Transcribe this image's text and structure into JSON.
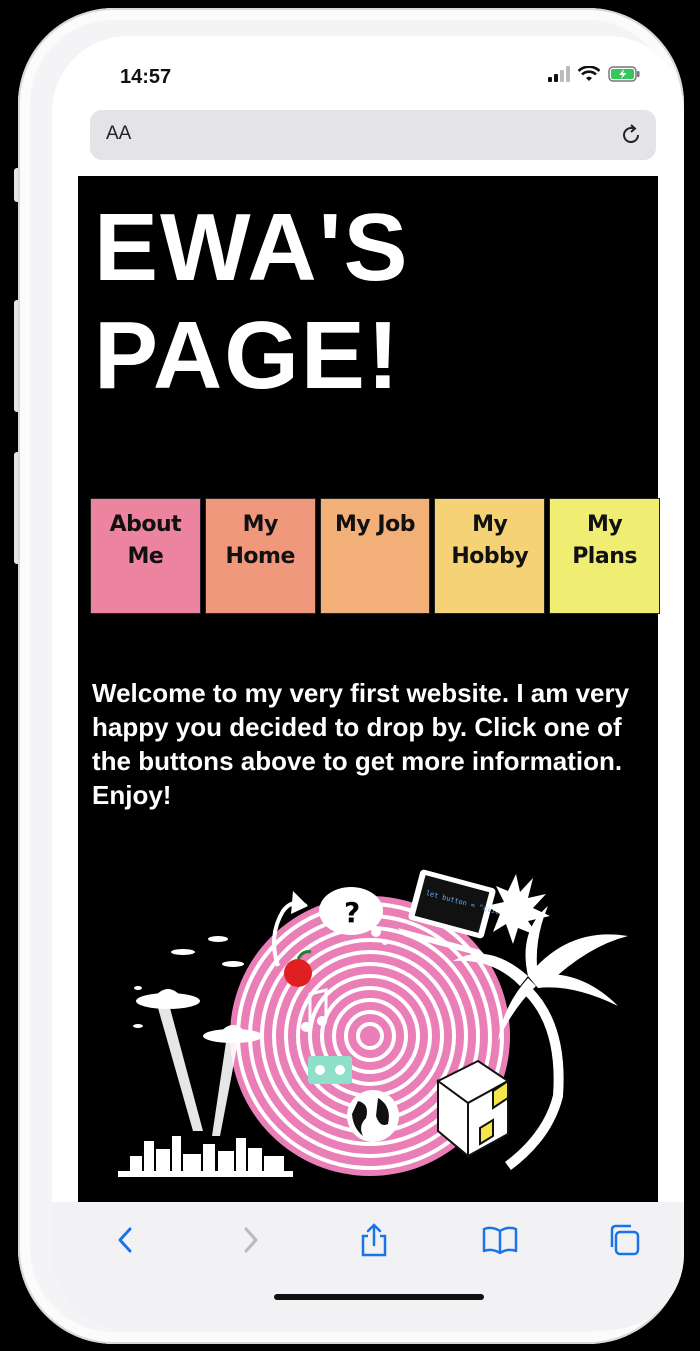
{
  "status": {
    "time": "14:57"
  },
  "browser": {
    "text_size_label": "AA"
  },
  "page": {
    "title_line1": "EWA'S",
    "title_line2": "PAGE!",
    "nav": [
      {
        "line1": "About",
        "line2": "Me",
        "color": "#ec84a0"
      },
      {
        "line1": "My",
        "line2": "Home",
        "color": "#f0987c"
      },
      {
        "line1": "My Job",
        "line2": "",
        "color": "#f2b078"
      },
      {
        "line1": "My",
        "line2": "Hobby",
        "color": "#f4d275"
      },
      {
        "line1": "My",
        "line2": "Plans",
        "color": "#efee72"
      }
    ],
    "welcome": "Welcome to my very first website. I am very happy you decided to drop by. Click one of the buttons above to get more information. Enjoy!",
    "illustration_code_text": "let button = \"click\";"
  },
  "colors": {
    "accent": "#1a73e8",
    "illustration_pink": "#e97fb6"
  }
}
